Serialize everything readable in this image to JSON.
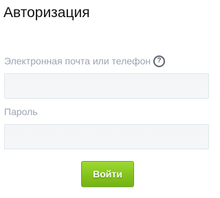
{
  "form": {
    "title": "Авторизация",
    "login_label": "Электронная почта или телефон",
    "login_help_icon": "question-circle-icon",
    "login_help_glyph": "?",
    "login_value": "",
    "password_label": "Пароль",
    "password_value": "",
    "submit_label": "Войти"
  },
  "colors": {
    "label": "#9ba3b3",
    "field_bg": "#f4f5f7",
    "button_green": "#86c51f"
  }
}
